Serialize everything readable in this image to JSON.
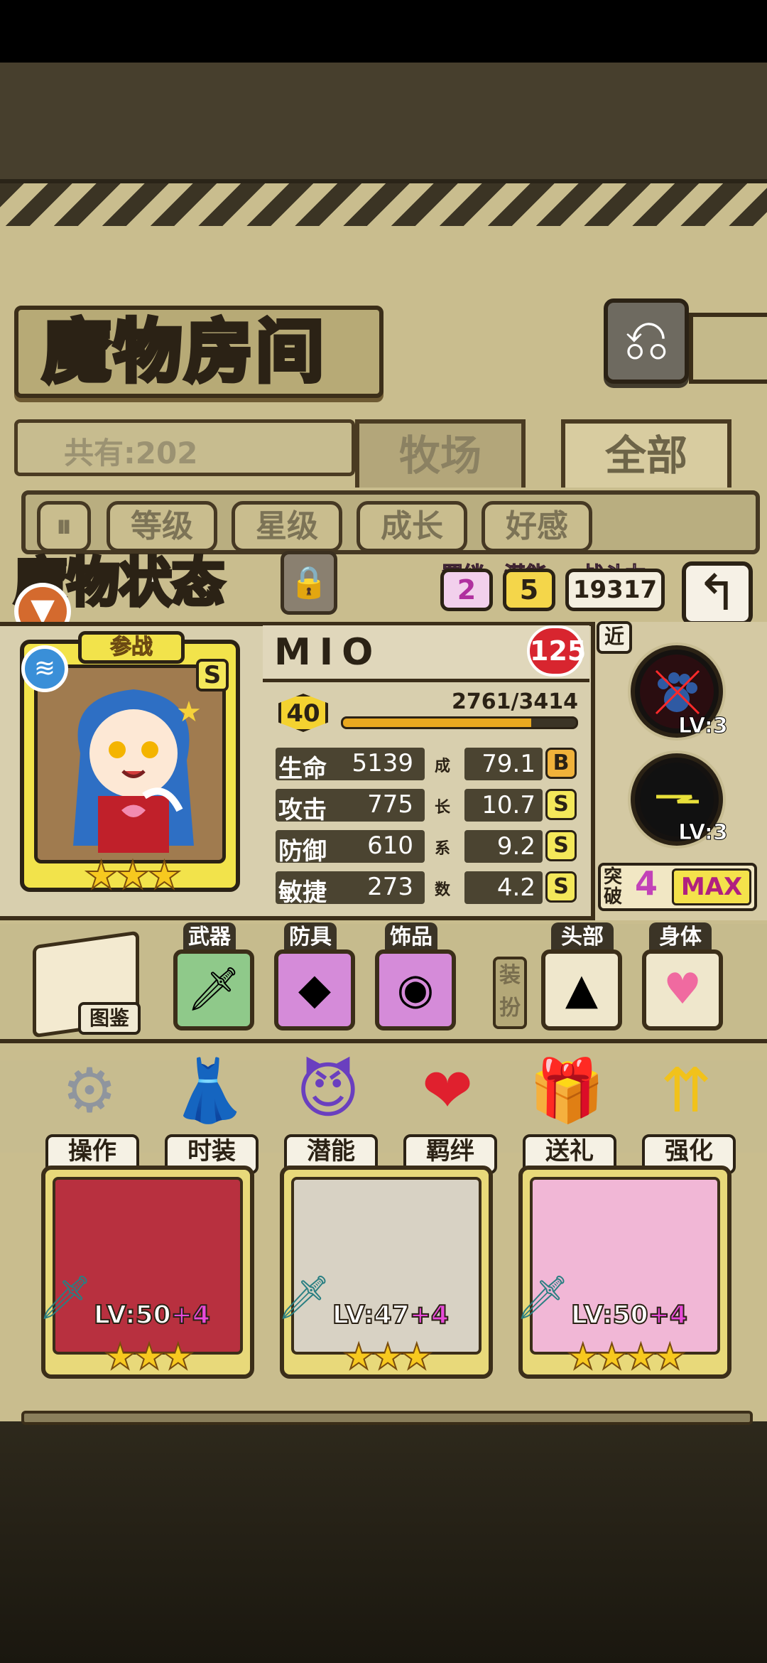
{
  "header": {
    "title": "魔物房间",
    "return_icon": "return-arrow-icon"
  },
  "collection": {
    "total_label": "共有:202"
  },
  "tabs": [
    {
      "label": "牧场"
    },
    {
      "label": "全部"
    }
  ],
  "sort": {
    "toggle_icon": "pause-icon",
    "options": [
      "等级",
      "星级",
      "成长",
      "好感"
    ]
  },
  "status": {
    "title": "魔物状态",
    "bond_label": "羁绊",
    "bond_value": "2",
    "potential_label": "潜能",
    "potential_value": "5",
    "power_label": "战斗力",
    "power_value": "19317"
  },
  "character": {
    "name": "MIO",
    "standby_label": "参战",
    "rank": "S",
    "rarity_stars": 3,
    "affection": "125",
    "level": "40",
    "exp_text": "2761/3414",
    "exp_fraction": 0.809,
    "growth_label": [
      "成",
      "长",
      "系",
      "数"
    ],
    "stats": [
      {
        "name": "生命",
        "value": "5139",
        "growth": "79.1",
        "grade": "B"
      },
      {
        "name": "攻击",
        "value": "775",
        "growth": "10.7",
        "grade": "S"
      },
      {
        "name": "防御",
        "value": "610",
        "growth": "9.2",
        "grade": "S"
      },
      {
        "name": "敏捷",
        "value": "273",
        "growth": "4.2",
        "grade": "S"
      }
    ],
    "range_label": "近",
    "skills": [
      {
        "level": "LV:3"
      },
      {
        "level": "LV:3"
      }
    ],
    "breakthrough_label": "突破",
    "breakthrough_value": "4",
    "max_label": "MAX"
  },
  "equipment": {
    "book_label": "图鉴",
    "slots": [
      {
        "label": "武器",
        "icon": "sword-icon"
      },
      {
        "label": "防具",
        "icon": "armor-icon"
      },
      {
        "label": "饰品",
        "icon": "eye-amulet-icon"
      }
    ],
    "dress_label": "装扮",
    "cosmetics": [
      {
        "label": "头部",
        "icon": "unicorn-horn-icon"
      },
      {
        "label": "身体",
        "icon": "winged-heart-icon"
      }
    ]
  },
  "actions": [
    {
      "label": "操作",
      "icon": "gear-icon"
    },
    {
      "label": "时装",
      "icon": "outfit-icon"
    },
    {
      "label": "潜能",
      "icon": "demon-icon"
    },
    {
      "label": "羁绊",
      "icon": "hearts-icon"
    },
    {
      "label": "送礼",
      "icon": "gift-icon"
    },
    {
      "label": "强化",
      "icon": "upgrade-arrows-icon"
    }
  ],
  "monsters": [
    {
      "level": "LV:50",
      "bonus": "+4",
      "stars": 3
    },
    {
      "level": "LV:47",
      "bonus": "+4",
      "stars": 3
    },
    {
      "level": "LV:50",
      "bonus": "+4",
      "stars": 4
    }
  ]
}
